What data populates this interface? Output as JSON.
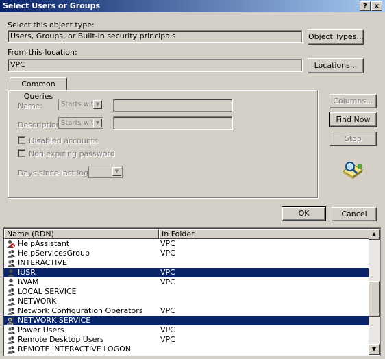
{
  "window": {
    "title": "Select Users or Groups",
    "help_label": "?",
    "close_label": "×"
  },
  "object_type": {
    "label": "Select this object type:",
    "value": "Users, Groups, or Built-in security principals",
    "button": "Object Types..."
  },
  "location": {
    "label": "From this location:",
    "value": "VPC",
    "button": "Locations..."
  },
  "queries": {
    "tab_label": "Common Queries",
    "name_label": "Name:",
    "name_mode": "Starts with",
    "description_label": "Description:",
    "description_mode": "Starts with",
    "disabled_accounts_label": "Disabled accounts",
    "non_expiring_label": "Non expiring password",
    "days_label": "Days since last logon:"
  },
  "buttons": {
    "columns": "Columns...",
    "find_now": "Find Now",
    "stop": "Stop",
    "ok": "OK",
    "cancel": "Cancel"
  },
  "results": {
    "columns": [
      "Name (RDN)",
      "In Folder"
    ],
    "rows": [
      {
        "name": "HelpAssistant",
        "folder": "VPC",
        "icon": "disabled-user-icon",
        "selected": false
      },
      {
        "name": "HelpServicesGroup",
        "folder": "VPC",
        "icon": "group-icon",
        "selected": false
      },
      {
        "name": "INTERACTIVE",
        "folder": "",
        "icon": "group-icon",
        "selected": false
      },
      {
        "name": "IUSR",
        "folder": "VPC",
        "icon": "user-icon",
        "selected": true
      },
      {
        "name": "IWAM",
        "folder": "VPC",
        "icon": "user-icon",
        "selected": false
      },
      {
        "name": "LOCAL SERVICE",
        "folder": "",
        "icon": "group-icon",
        "selected": false
      },
      {
        "name": "NETWORK",
        "folder": "",
        "icon": "group-icon",
        "selected": false
      },
      {
        "name": "Network Configuration Operators",
        "folder": "VPC",
        "icon": "group-icon",
        "selected": false
      },
      {
        "name": "NETWORK SERVICE",
        "folder": "",
        "icon": "group-icon",
        "selected": true
      },
      {
        "name": "Power Users",
        "folder": "VPC",
        "icon": "group-icon",
        "selected": false
      },
      {
        "name": "Remote Desktop Users",
        "folder": "VPC",
        "icon": "group-icon",
        "selected": false
      },
      {
        "name": "REMOTE INTERACTIVE LOGON",
        "folder": "",
        "icon": "group-icon",
        "selected": false
      }
    ]
  },
  "colors": {
    "title_start": "#0a246a",
    "title_end": "#a6caf0",
    "selection": "#0a246a",
    "face": "#d4d0c8"
  }
}
